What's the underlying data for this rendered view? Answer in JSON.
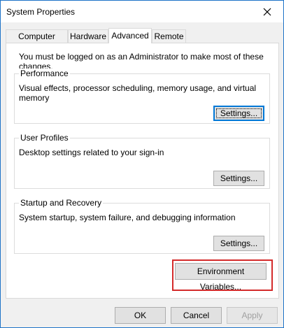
{
  "window": {
    "title": "System Properties",
    "close_icon": "close-icon"
  },
  "tabs": [
    {
      "label": "Computer Name",
      "active": false
    },
    {
      "label": "Hardware",
      "active": false
    },
    {
      "label": "Advanced",
      "active": true
    },
    {
      "label": "Remote",
      "active": false
    }
  ],
  "advanced": {
    "admin_message": "You must be logged on as an Administrator to make most of these changes.",
    "performance": {
      "title": "Performance",
      "description": "Visual effects, processor scheduling, memory usage, and virtual memory",
      "button": "Settings..."
    },
    "user_profiles": {
      "title": "User Profiles",
      "description": "Desktop settings related to your sign-in",
      "button": "Settings..."
    },
    "startup_recovery": {
      "title": "Startup and Recovery",
      "description": "System startup, system failure, and debugging information",
      "button": "Settings..."
    },
    "env_button": "Environment Variables..."
  },
  "footer": {
    "ok": "OK",
    "cancel": "Cancel",
    "apply": "Apply"
  },
  "colors": {
    "highlight": "#d42b2b",
    "focus_border": "#0078d7"
  }
}
